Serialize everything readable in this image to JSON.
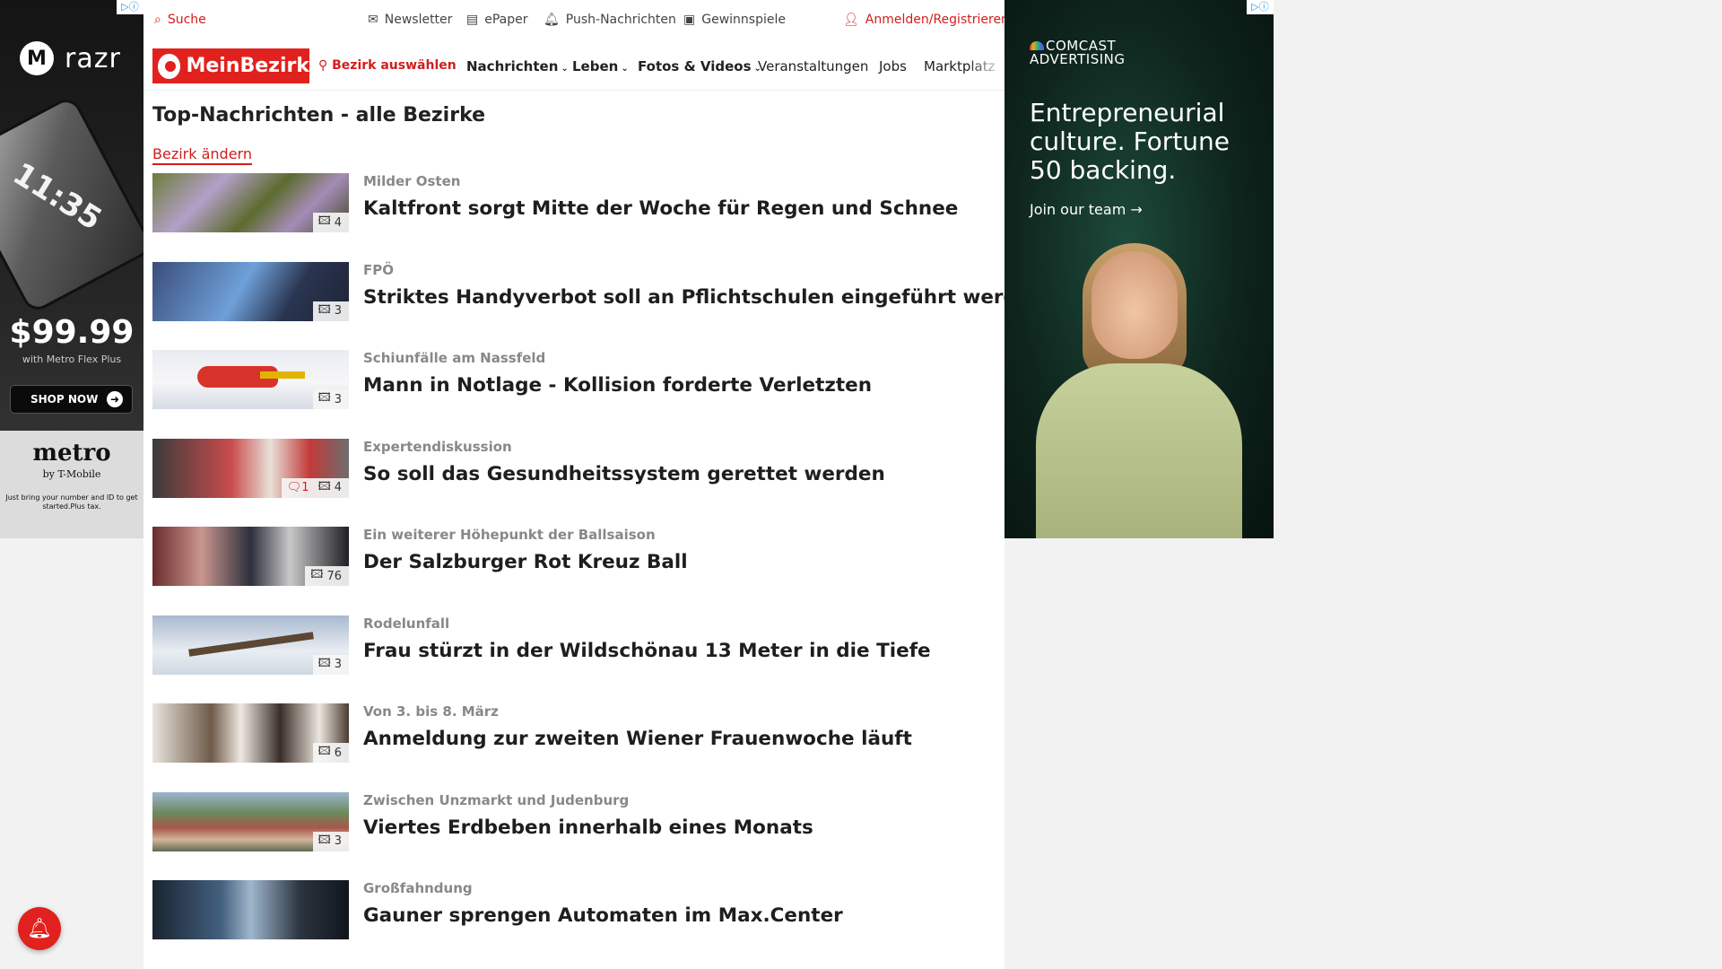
{
  "topbar": {
    "search": "Suche",
    "newsletter": "Newsletter",
    "epaper": "ePaper",
    "push": "Push-Nachrichten",
    "gewinnspiele": "Gewinnspiele",
    "login": "Anmelden/Registrieren"
  },
  "nav": {
    "logo": "MeinBezirk",
    "bezirk": "Bezirk auswählen",
    "items": [
      "Nachrichten",
      "Leben",
      "Fotos & Videos",
      "Veranstaltungen",
      "Jobs",
      "Marktplatz"
    ]
  },
  "page": {
    "title": "Top-Nachrichten - alle Bezirke",
    "change_link": "Bezirk ändern"
  },
  "articles": [
    {
      "kicker": "Milder Osten",
      "headline": "Kaltfront sorgt Mitte der Woche für Regen und Schnee",
      "photos": "4",
      "comments": ""
    },
    {
      "kicker": "FPÖ",
      "headline": "Striktes Handyverbot soll an Pflichtschulen eingeführt werden",
      "photos": "3",
      "comments": ""
    },
    {
      "kicker": "Schiunfälle am Nassfeld",
      "headline": "Mann in Notlage - Kollision forderte Verletzten",
      "photos": "3",
      "comments": ""
    },
    {
      "kicker": "Expertendiskussion",
      "headline": "So soll das Gesundheitssystem gerettet werden",
      "photos": "4",
      "comments": "1"
    },
    {
      "kicker": "Ein weiterer Höhepunkt der Ballsaison",
      "headline": "Der Salzburger Rot Kreuz Ball",
      "photos": "76",
      "comments": ""
    },
    {
      "kicker": "Rodelunfall",
      "headline": "Frau stürzt in der Wildschönau 13 Meter in die Tiefe",
      "photos": "3",
      "comments": ""
    },
    {
      "kicker": "Von 3. bis 8. März",
      "headline": "Anmeldung zur zweiten Wiener Frauenwoche läuft",
      "photos": "6",
      "comments": ""
    },
    {
      "kicker": "Zwischen Unzmarkt und Judenburg",
      "headline": "Viertes Erdbeben innerhalb eines Monats",
      "photos": "3",
      "comments": ""
    },
    {
      "kicker": "Großfahndung",
      "headline": "Gauner sprengen Automaten im Max.Center",
      "photos": "",
      "comments": ""
    }
  ],
  "ad_left": {
    "brand": "razr",
    "phone_time": "11:35",
    "price": "$99.99",
    "price_sub": "with Metro Flex Plus",
    "cta": "SHOP NOW",
    "metro": "metro",
    "metro_sub": "by T-Mobile",
    "fine_print": "Just bring your number and ID to get started.Plus tax."
  },
  "ad_right": {
    "logo_line1": "COMCAST",
    "logo_line2": "ADVERTISING",
    "headline": "Entrepreneurial culture. Fortune 50 backing.",
    "cta": "Join our team →"
  },
  "colors": {
    "brand_red": "#e1211e",
    "link_red": "#d21d1d"
  }
}
